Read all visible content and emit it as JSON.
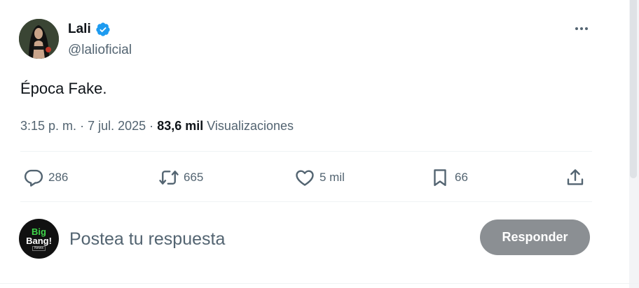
{
  "tweet": {
    "author_name": "Lali",
    "handle": "@lalioficial",
    "text": "Época Fake.",
    "time": "3:15 p. m.",
    "date": "7 jul. 2025",
    "views_count": "83,6 mil",
    "views_label": "Visualizaciones",
    "separator": "·"
  },
  "actions": {
    "replies": "286",
    "reposts": "665",
    "likes": "5 mil",
    "bookmarks": "66"
  },
  "reply_box": {
    "avatar_line1": "Big",
    "avatar_line2": "Bang!",
    "avatar_line3": "News",
    "placeholder": "Postea tu respuesta",
    "button_label": "Responder"
  },
  "icons": {
    "verified": "verified-badge-icon",
    "more": "more-icon",
    "reply": "reply-icon",
    "repost": "repost-icon",
    "like": "heart-icon",
    "bookmark": "bookmark-icon",
    "share": "share-icon"
  },
  "colors": {
    "verified_blue": "#1d9bf0",
    "secondary_text": "#536471",
    "button_disabled": "#8b8f93"
  }
}
